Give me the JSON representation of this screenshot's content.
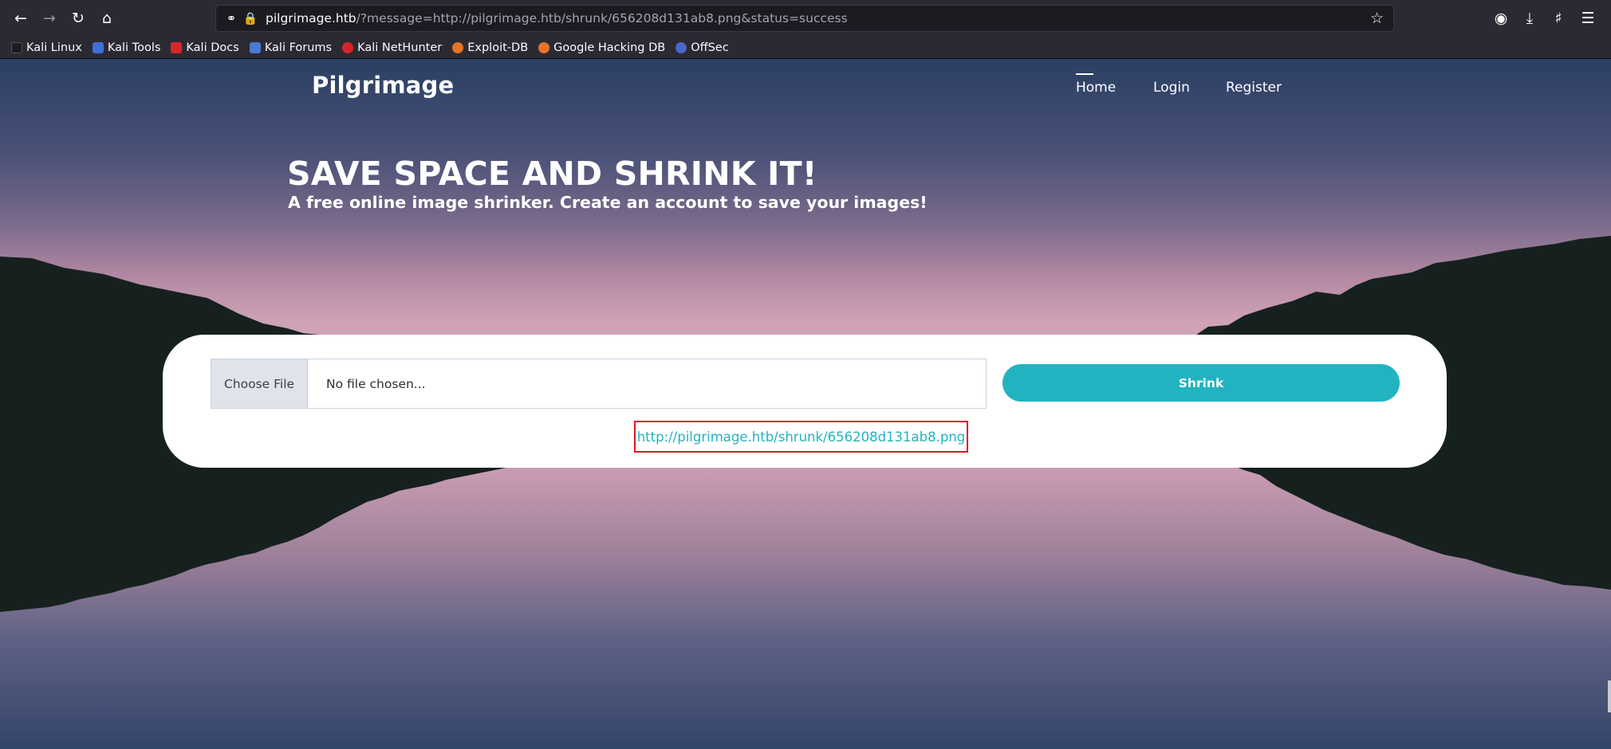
{
  "browser": {
    "url_host": "pilgrimage.htb",
    "url_rest": "/?message=http://pilgrimage.htb/shrunk/656208d131ab8.png&status=success",
    "nav_icons": [
      "back-arrow-icon",
      "forward-arrow-icon",
      "reload-icon",
      "home-icon"
    ],
    "right_icons": [
      "pocket-icon",
      "download-icon",
      "extensions-icon",
      "menu-icon"
    ]
  },
  "bookmarks": [
    {
      "label": "Kali Linux",
      "color": "#1d1d1d"
    },
    {
      "label": "Kali Tools",
      "color": "#3f6fd8"
    },
    {
      "label": "Kali Docs",
      "color": "#d6262a"
    },
    {
      "label": "Kali Forums",
      "color": "#4b79d3"
    },
    {
      "label": "Kali NetHunter",
      "color": "#d6262a"
    },
    {
      "label": "Exploit-DB",
      "color": "#e4752a"
    },
    {
      "label": "Google Hacking DB",
      "color": "#e4752a"
    },
    {
      "label": "OffSec",
      "color": "#4a67c9"
    }
  ],
  "site": {
    "brand": "Pilgrimage",
    "nav": {
      "home": "Home",
      "login": "Login",
      "register": "Register"
    },
    "hero_title": "SAVE SPACE AND SHRINK IT!",
    "hero_subtitle": "A free online image shrinker. Create an account to save your images!"
  },
  "upload": {
    "choose_label": "Choose File",
    "file_name": "No file chosen...",
    "shrink_label": "Shrink",
    "result_url": "http://pilgrimage.htb/shrunk/656208d131ab8.png"
  },
  "colors": {
    "accent": "#22b3c1",
    "highlight_border": "#e3141d"
  }
}
